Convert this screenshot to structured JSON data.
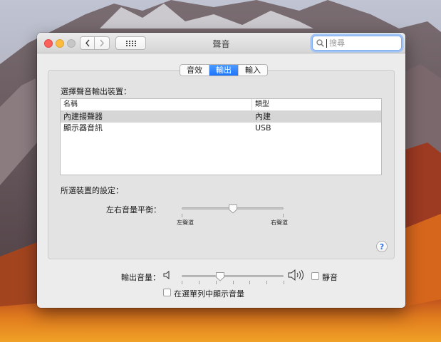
{
  "window": {
    "title": "聲音",
    "search": {
      "placeholder": "搜尋",
      "value": ""
    }
  },
  "tabs": [
    {
      "label": "音效",
      "active": false
    },
    {
      "label": "輸出",
      "active": true
    },
    {
      "label": "輸入",
      "active": false
    }
  ],
  "output": {
    "select_device_label": "選擇聲音輸出裝置：",
    "table": {
      "columns": [
        "名稱",
        "類型"
      ],
      "rows": [
        {
          "name": "內建揚聲器",
          "type": "內建",
          "selected": true
        },
        {
          "name": "顯示器音訊",
          "type": "USB",
          "selected": false
        }
      ]
    },
    "selected_device_settings_label": "所選裝置的設定：",
    "balance": {
      "label": "左右音量平衡：",
      "left_label": "左聲道",
      "right_label": "右聲道",
      "value": 0.5
    },
    "help_symbol": "?"
  },
  "footer": {
    "output_volume_label": "輸出音量：",
    "output_volume_value": 0.38,
    "mute_label": "靜音",
    "mute_checked": false,
    "show_in_menubar_label": "在選單列中顯示音量",
    "show_in_menubar_checked": false
  },
  "colors": {
    "accent": "#1d74fa",
    "selection_row": "#d6d6d6",
    "search_focus": "#9fc4f5"
  }
}
